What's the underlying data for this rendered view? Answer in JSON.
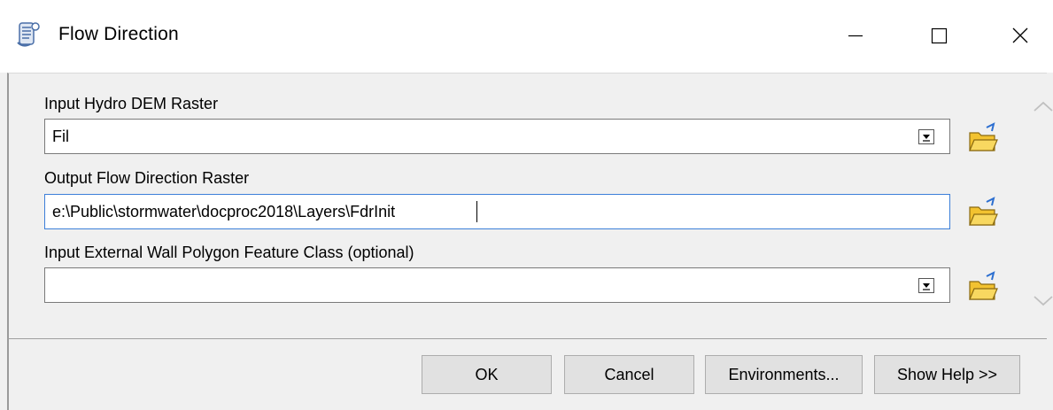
{
  "window": {
    "title": "Flow Direction",
    "controls": {
      "minimize": "—",
      "maximize": "☐",
      "close": "✕"
    }
  },
  "form": {
    "hydro_dem": {
      "label": "Input Hydro DEM Raster",
      "value": "Fil"
    },
    "output_fdr": {
      "label": "Output Flow Direction Raster",
      "value": "e:\\Public\\stormwater\\docproc2018\\Layers\\FdrInit"
    },
    "wall_polygon": {
      "label": "Input External Wall Polygon Feature Class (optional)",
      "value": ""
    }
  },
  "buttons": {
    "ok": "OK",
    "cancel": "Cancel",
    "environments": "Environments...",
    "show_help": "Show Help >>"
  },
  "colors": {
    "active_border": "#3c7fd9",
    "folder_yellow": "#f2c230"
  }
}
